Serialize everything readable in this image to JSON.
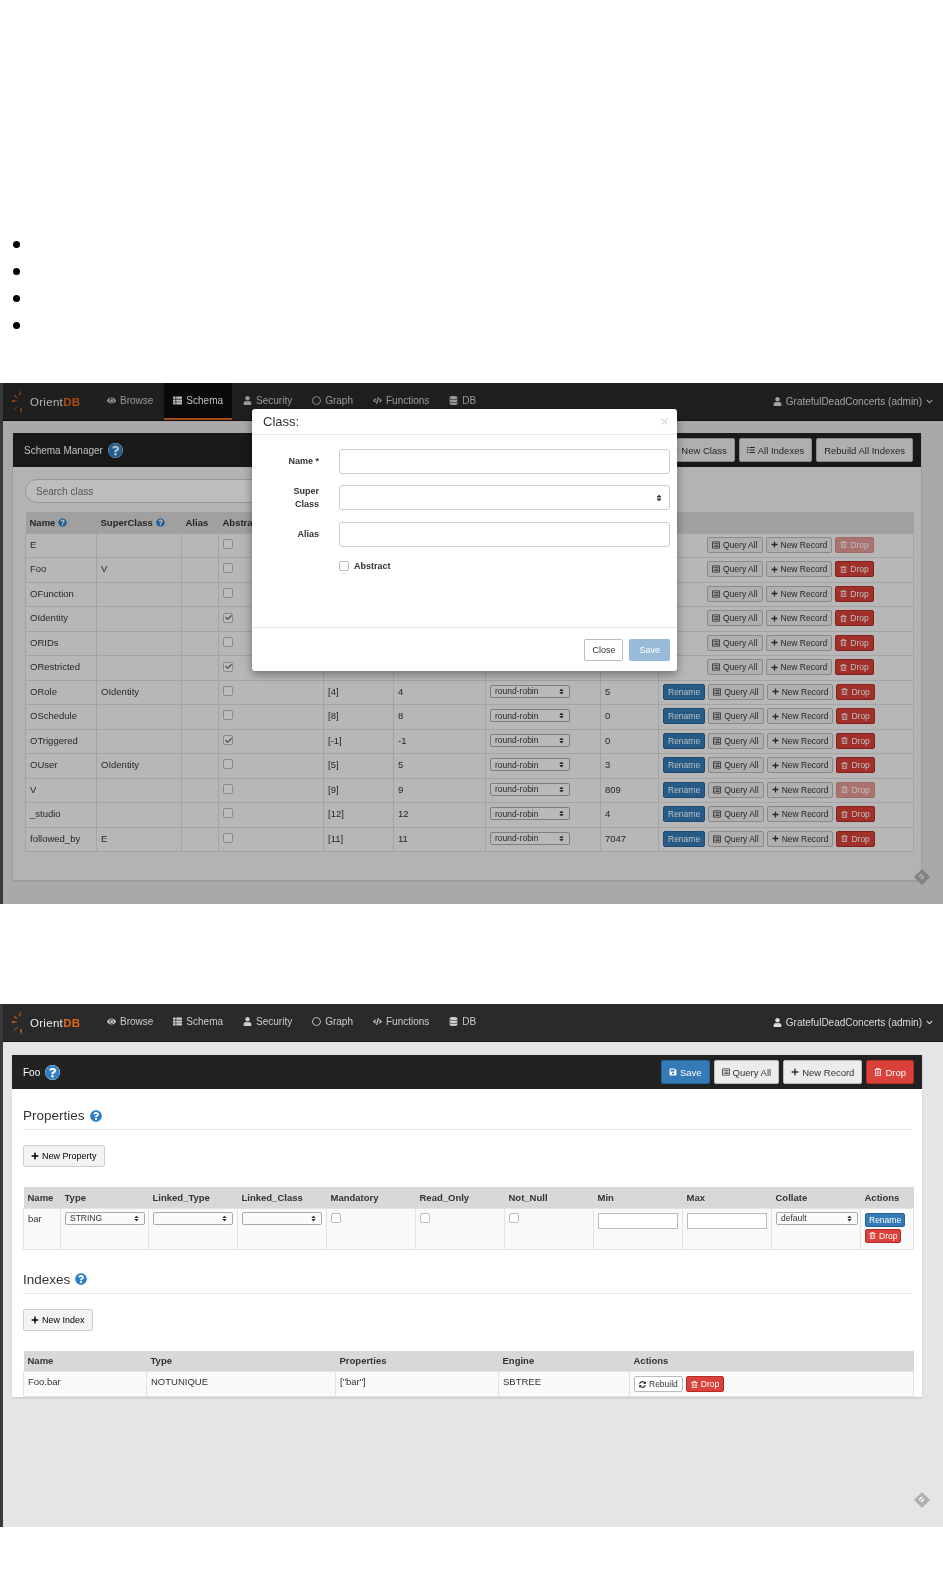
{
  "schema_view": {
    "nav": {
      "logo": {
        "name": "Orient",
        "accent": "DB"
      },
      "items": [
        {
          "kind": "browse",
          "label": "Browse",
          "selected": false
        },
        {
          "kind": "schema",
          "label": "Schema",
          "selected": true
        },
        {
          "kind": "security",
          "label": "Security",
          "selected": false
        },
        {
          "kind": "graph",
          "label": "Graph",
          "selected": false
        },
        {
          "kind": "functions",
          "label": "Functions",
          "selected": false
        },
        {
          "kind": "db",
          "label": "DB",
          "selected": false
        }
      ],
      "user": "GratefulDeadConcerts (admin)"
    },
    "panel": {
      "title": "Schema Manager",
      "buttons": [
        {
          "kind": "new",
          "label": "New Class"
        },
        {
          "kind": "list",
          "label": "All Indexes"
        },
        {
          "kind": "plain",
          "label": "Rebuild All Indexes"
        }
      ],
      "search_placeholder": "Search class",
      "columns": [
        {
          "label": "Name",
          "help": true
        },
        {
          "label": "SuperClass",
          "help": true
        },
        {
          "label": "Alias",
          "help": false
        },
        {
          "label": "Abstra",
          "help": false
        }
      ],
      "rows": [
        {
          "name": "E",
          "abstract": false,
          "query": "Query All",
          "new_record": "New Record",
          "drop": "Drop",
          "drop_disabled": true
        },
        {
          "name": "Foo",
          "superclass": "V",
          "abstract": false,
          "query": "Query All",
          "new_record": "New Record",
          "drop": "Drop",
          "drop_disabled": false
        },
        {
          "name": "OFunction",
          "abstract": false,
          "query": "Query All",
          "new_record": "New Record",
          "drop": "Drop",
          "drop_disabled": false
        },
        {
          "name": "OIdentity",
          "abstract": true,
          "query": "Query All",
          "new_record": "New Record",
          "drop": "Drop",
          "drop_disabled": false
        },
        {
          "name": "ORIDs",
          "abstract": false,
          "query": "Query All",
          "new_record": "New Record",
          "drop": "Drop",
          "drop_disabled": false
        },
        {
          "name": "ORestricted",
          "abstract": true,
          "query": "Query All",
          "new_record": "New Record",
          "drop": "Drop",
          "drop_disabled": false
        },
        {
          "name": "ORole",
          "superclass": "OIdentity",
          "abstract": false,
          "clusters": "[4]",
          "default_cluster": "4",
          "selection": "round-robin",
          "records": "5",
          "rename": "Rename",
          "query": "Query All",
          "new_record": "New Record",
          "drop": "Drop",
          "drop_disabled": false
        },
        {
          "name": "OSchedule",
          "abstract": false,
          "clusters": "[8]",
          "default_cluster": "8",
          "selection": "round-robin",
          "records": "0",
          "rename": "Rename",
          "query": "Query All",
          "new_record": "New Record",
          "drop": "Drop",
          "drop_disabled": false
        },
        {
          "name": "OTriggered",
          "abstract": true,
          "clusters": "[-1]",
          "default_cluster": "-1",
          "selection": "round-robin",
          "records": "0",
          "rename": "Rename",
          "query": "Query All",
          "new_record": "New Record",
          "drop": "Drop",
          "drop_disabled": false
        },
        {
          "name": "OUser",
          "superclass": "OIdentity",
          "abstract": false,
          "clusters": "[5]",
          "default_cluster": "5",
          "selection": "round-robin",
          "records": "3",
          "rename": "Rename",
          "query": "Query All",
          "new_record": "New Record",
          "drop": "Drop",
          "drop_disabled": false
        },
        {
          "name": "V",
          "abstract": false,
          "clusters": "[9]",
          "default_cluster": "9",
          "selection": "round-robin",
          "records": "809",
          "rename": "Rename",
          "query": "Query All",
          "new_record": "New Record",
          "drop": "Drop",
          "drop_disabled": true
        },
        {
          "name": "_studio",
          "abstract": false,
          "clusters": "[12]",
          "default_cluster": "12",
          "selection": "round-robin",
          "records": "4",
          "rename": "Rename",
          "query": "Query All",
          "new_record": "New Record",
          "drop": "Drop",
          "drop_disabled": false
        },
        {
          "name": "followed_by",
          "superclass": "E",
          "abstract": false,
          "clusters": "[11]",
          "default_cluster": "11",
          "selection": "round-robin",
          "records": "7047",
          "rename": "Rename",
          "query": "Query All",
          "new_record": "New Record",
          "drop": "Drop",
          "drop_disabled": false
        }
      ]
    },
    "dialog": {
      "title": "Class:",
      "fields": [
        {
          "kind": "text",
          "label": "Name *"
        },
        {
          "kind": "select",
          "label": "Super Class"
        },
        {
          "kind": "text",
          "label": "Alias"
        }
      ],
      "abstract": {
        "label": "Abstract",
        "checked": false
      },
      "close": "Close",
      "save": {
        "label": "Save",
        "disabled": true
      }
    }
  },
  "class_view": {
    "nav": {
      "logo": {
        "name": "Orient",
        "accent": "DB"
      },
      "items": [
        {
          "kind": "browse",
          "label": "Browse",
          "selected": false
        },
        {
          "kind": "schema",
          "label": "Schema",
          "selected": false
        },
        {
          "kind": "security",
          "label": "Security",
          "selected": false
        },
        {
          "kind": "graph",
          "label": "Graph",
          "selected": false
        },
        {
          "kind": "functions",
          "label": "Functions",
          "selected": false
        },
        {
          "kind": "db",
          "label": "DB",
          "selected": false
        }
      ],
      "user": "GratefulDeadConcerts (admin)"
    },
    "panel": {
      "title": "Foo",
      "buttons": [
        {
          "kind": "save",
          "label": "Save"
        },
        {
          "kind": "query",
          "label": "Query All"
        },
        {
          "kind": "new",
          "label": "New Record"
        },
        {
          "kind": "drop",
          "label": "Drop"
        }
      ]
    },
    "properties": {
      "title": "Properties",
      "add": "New Property",
      "columns": [
        "Name",
        "Type",
        "Linked_Type",
        "Linked_Class",
        "Mandatory",
        "Read_Only",
        "Not_Null",
        "Min",
        "Max",
        "Collate",
        "Actions"
      ],
      "rows": [
        {
          "name": "bar",
          "type": "STRING",
          "mandatory": false,
          "read_only": false,
          "not_null": false,
          "collate": "default",
          "rename": "Rename",
          "drop": "Drop"
        }
      ]
    },
    "indexes": {
      "title": "Indexes",
      "add": "New Index",
      "columns": [
        "Name",
        "Type",
        "Properties",
        "Engine",
        "Actions"
      ],
      "rows": [
        {
          "name": "Foo.bar",
          "type": "NOTUNIQUE",
          "properties": "[\"bar\"]",
          "engine": "SBTREE",
          "rebuild": "Rebuild",
          "drop": "Drop"
        }
      ]
    }
  }
}
